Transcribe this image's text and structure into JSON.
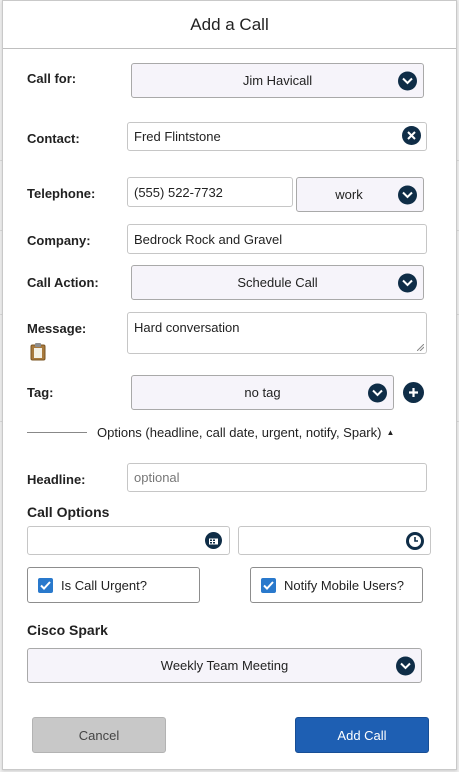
{
  "dialog": {
    "title": "Add a Call"
  },
  "call_for": {
    "label": "Call for:",
    "value": "Jim Havicall"
  },
  "contact": {
    "label": "Contact:",
    "value": "Fred Flintstone"
  },
  "telephone": {
    "label": "Telephone:",
    "value": "(555) 522-7732",
    "type": "work"
  },
  "company": {
    "label": "Company:",
    "value": "Bedrock Rock and Gravel"
  },
  "call_action": {
    "label": "Call Action:",
    "value": "Schedule Call"
  },
  "message": {
    "label": "Message:",
    "value": "Hard conversation"
  },
  "tag": {
    "label": "Tag:",
    "value": "no tag"
  },
  "options_toggle": {
    "label": "Options (headline, call date, urgent, notify, Spark)"
  },
  "headline": {
    "label": "Headline:",
    "placeholder": "optional"
  },
  "call_options": {
    "title": "Call Options",
    "urgent_label": "Is Call Urgent?",
    "urgent_checked": true,
    "notify_label": "Notify Mobile Users?",
    "notify_checked": true
  },
  "cisco_spark": {
    "title": "Cisco Spark",
    "value": "Weekly Team Meeting"
  },
  "buttons": {
    "cancel": "Cancel",
    "add": "Add Call"
  },
  "colors": {
    "accent_dark": "#0f2d47",
    "primary": "#1e5fb3",
    "checkbox": "#2979cc"
  }
}
